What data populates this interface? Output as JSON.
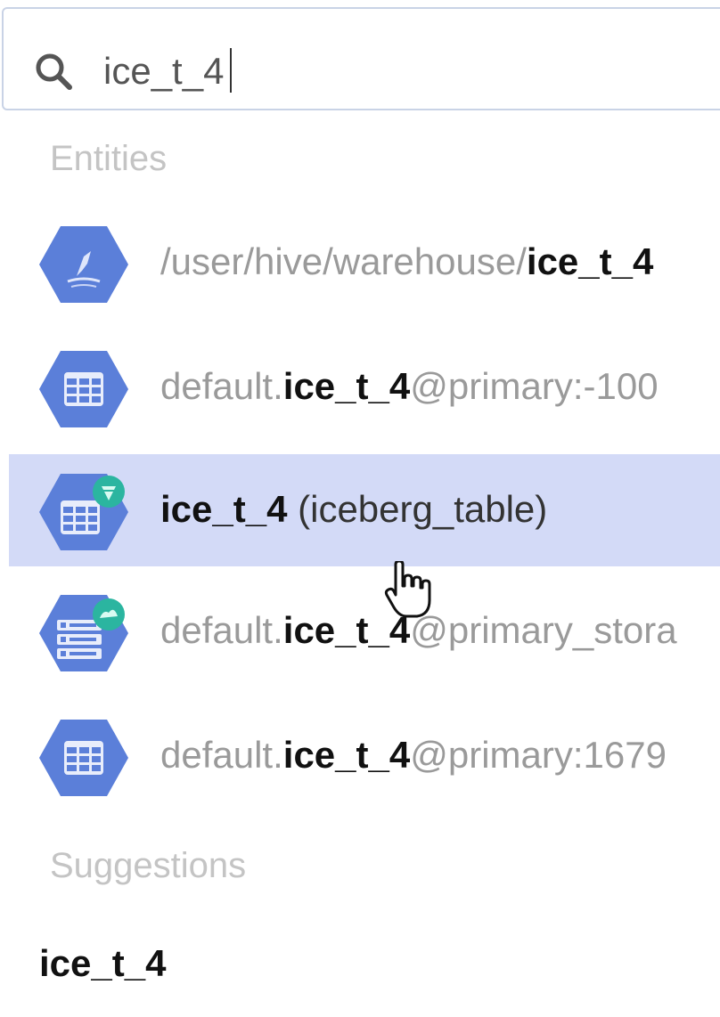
{
  "search": {
    "value": "ice_t_4",
    "icon": "search-icon"
  },
  "sections": {
    "entities_label": "Entities",
    "suggestions_label": "Suggestions"
  },
  "entities": [
    {
      "icon": "hdfs-path-icon",
      "prefix": "/user/hive/warehouse/",
      "match": "ice_t_4",
      "suffix": ""
    },
    {
      "icon": "table-icon",
      "prefix": "default.",
      "match": "ice_t_4",
      "suffix": "@primary:-100"
    },
    {
      "icon": "iceberg-table-icon",
      "prefix": "",
      "match": "ice_t_4",
      "suffix": " (iceberg_table)"
    },
    {
      "icon": "storage-table-icon",
      "prefix": "default.",
      "match": "ice_t_4",
      "suffix": "@primary_stora"
    },
    {
      "icon": "table-icon",
      "prefix": "default.",
      "match": "ice_t_4",
      "suffix": "@primary:1679"
    }
  ],
  "suggestions": [
    {
      "label": "ice_t_4"
    }
  ],
  "colors": {
    "hexagon": "#5b7fd9",
    "selected_row": "#d3daf7",
    "badge": "#2bb5a0"
  }
}
